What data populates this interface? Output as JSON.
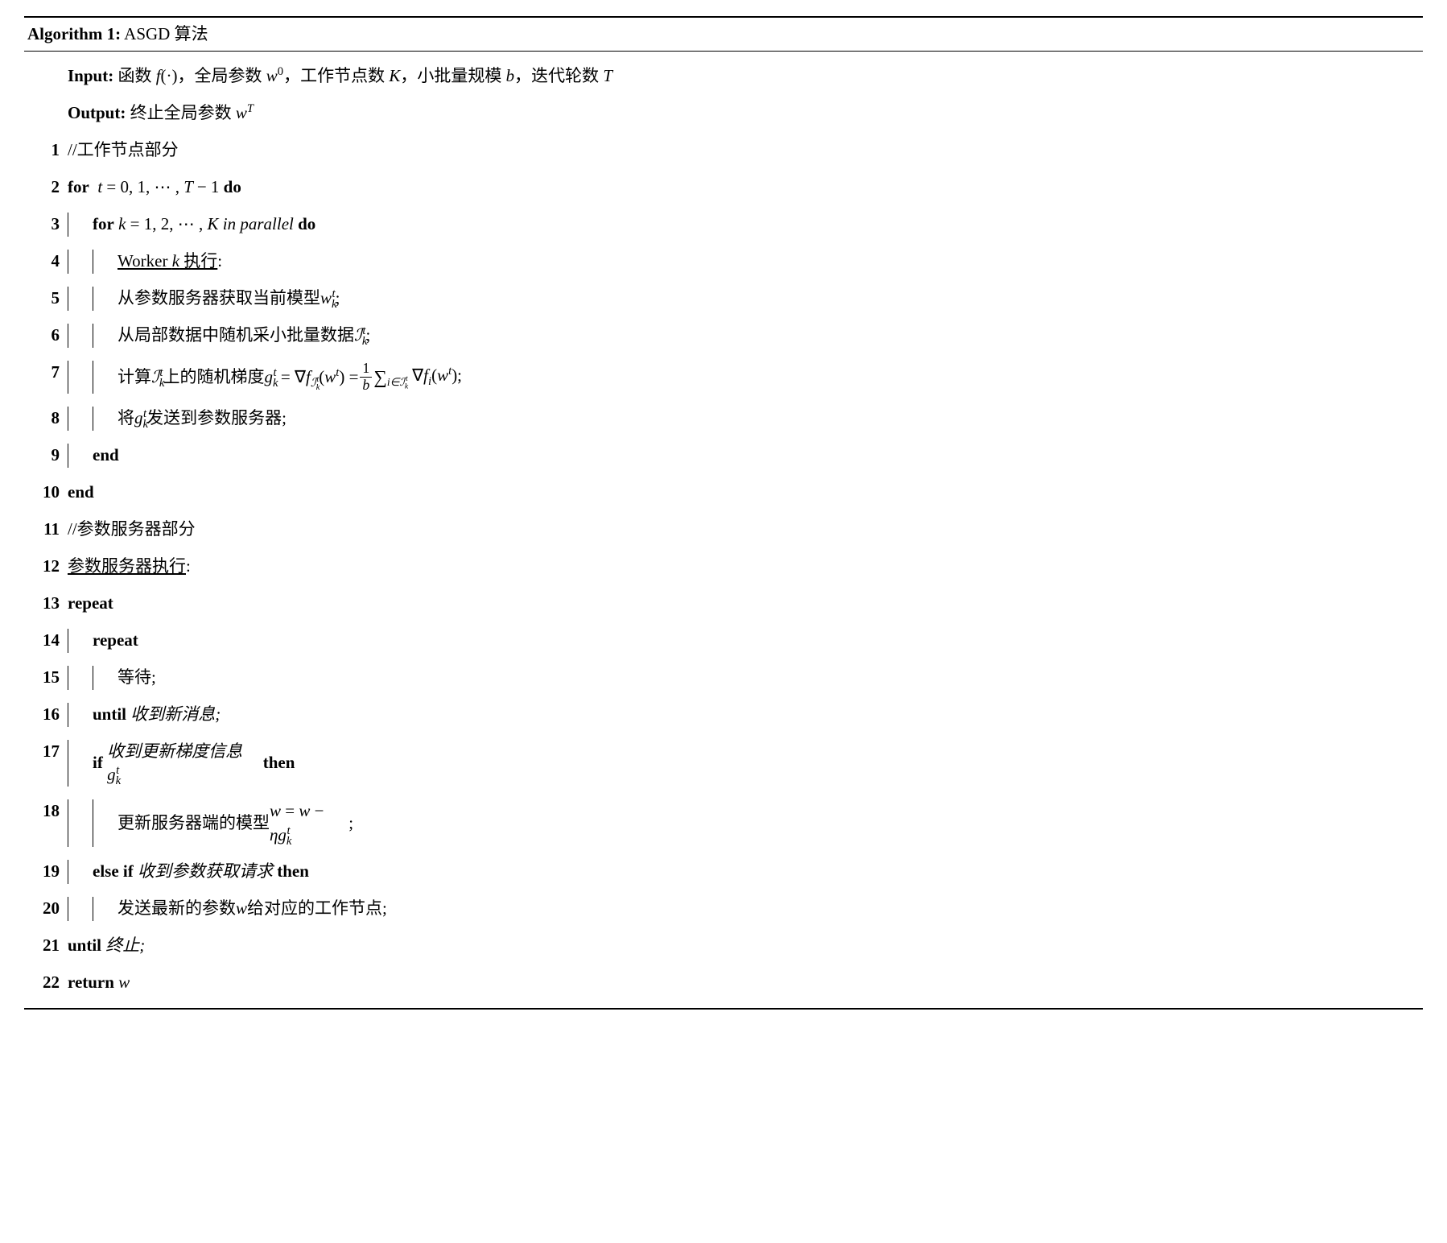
{
  "algorithm": {
    "number": "Algorithm 1:",
    "title": "ASGD 算法",
    "input_label": "Input:",
    "input_text": "函数 f(·)，全局参数 w⁰，工作节点数 K，小批量规模 b，迭代轮数 T",
    "output_label": "Output:",
    "output_text": "终止全局参数 wᵀ",
    "lines": {
      "l1": "//工作节点部分",
      "l2_for": "for",
      "l2_cond": "t = 0, 1, ⋯ , T − 1",
      "l2_do": "do",
      "l3_for": "for",
      "l3_cond": "k = 1, 2, ⋯ , K",
      "l3_inpar": "in parallel",
      "l3_do": "do",
      "l4": "Worker k 执行",
      "l5": "从参数服务器获取当前模型 wₖᵗ;",
      "l6": "从局部数据中随机采小批量数据 ℐₖᵗ;",
      "l7_pre": "计算 ℐₖᵗ 上的随机梯度 gₖᵗ = ∇f_ℐₖᵗ(wᵗ) = ",
      "l7_post": " ∑_{i∈ℐₖᵗ} ∇fᵢ(wᵗ);",
      "l8": "将 gₖᵗ 发送到参数服务器;",
      "l9": "end",
      "l10": "end",
      "l11": "//参数服务器部分",
      "l12": "参数服务器执行",
      "l13": "repeat",
      "l14": "repeat",
      "l15": "等待;",
      "l16_until": "until",
      "l16_text": "收到新消息;",
      "l17_if": "if",
      "l17_cond": "收到更新梯度信息 gₖᵗ",
      "l17_then": "then",
      "l18": "更新服务器端的模型 w = w − ηgₖᵗ;",
      "l19_elseif": "else if",
      "l19_cond": "收到参数获取请求",
      "l19_then": "then",
      "l20": "发送最新的参数 w 给对应的工作节点;",
      "l21_until": "until",
      "l21_text": "终止;",
      "l22_return": "return",
      "l22_val": "w"
    }
  }
}
